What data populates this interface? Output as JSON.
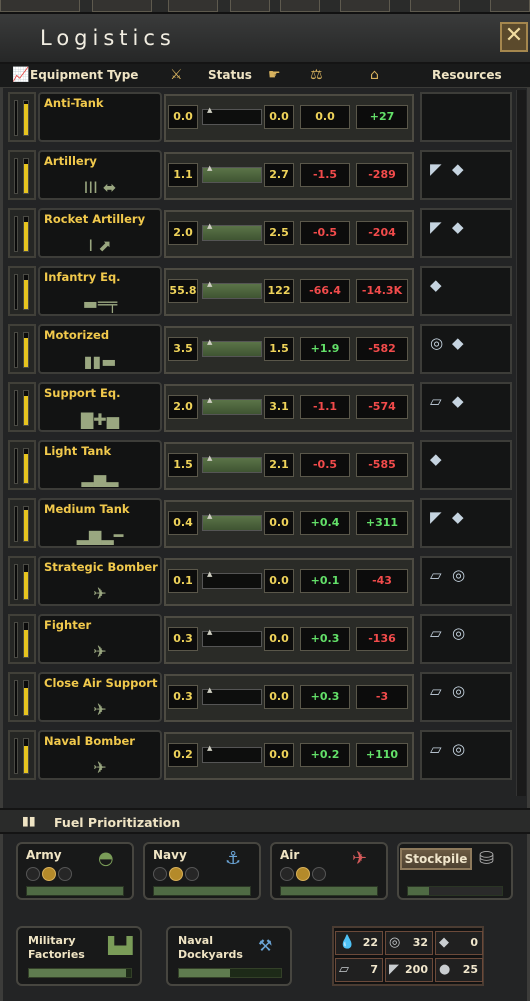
{
  "window": {
    "title": "Logistics",
    "close_label": "✕"
  },
  "header": {
    "equipment_type": "Equipment Type",
    "status": "Status",
    "resources": "Resources"
  },
  "rows": [
    {
      "name": "Anti-Tank",
      "icon": "",
      "fill": 0.9,
      "a": "0.0",
      "b": "0.0",
      "c": "0.0",
      "d": "+27",
      "c_color": "y",
      "d_color": "g",
      "track_on": false,
      "resources": []
    },
    {
      "name": "Artillery",
      "icon": "III ⬌",
      "fill": 0.85,
      "a": "1.1",
      "b": "2.7",
      "c": "-1.5",
      "d": "-289",
      "c_color": "r",
      "d_color": "r",
      "track_on": true,
      "resources": [
        "steel-icon",
        "tungsten-icon"
      ]
    },
    {
      "name": "Rocket Artillery",
      "icon": "I ⬈",
      "fill": 0.85,
      "a": "2.0",
      "b": "2.5",
      "c": "-0.5",
      "d": "-204",
      "c_color": "r",
      "d_color": "r",
      "track_on": true,
      "resources": [
        "steel-icon",
        "tungsten-icon"
      ]
    },
    {
      "name": "Infantry Eq.",
      "icon": "▬═╤",
      "fill": 0.85,
      "a": "55.8",
      "b": "122",
      "c": "-66.4",
      "d": "-14.3K",
      "c_color": "r",
      "d_color": "r",
      "track_on": true,
      "resources": [
        "tungsten-icon"
      ]
    },
    {
      "name": "Motorized",
      "icon": "▮▮▬",
      "fill": 0.85,
      "a": "3.5",
      "b": "1.5",
      "c": "+1.9",
      "d": "-582",
      "c_color": "g",
      "d_color": "r",
      "track_on": true,
      "resources": [
        "rubber-icon",
        "tungsten-icon"
      ]
    },
    {
      "name": "Support Eq.",
      "icon": "▇✚▅",
      "fill": 0.85,
      "a": "2.0",
      "b": "3.1",
      "c": "-1.1",
      "d": "-574",
      "c_color": "r",
      "d_color": "r",
      "track_on": true,
      "resources": [
        "aluminium-icon",
        "tungsten-icon"
      ]
    },
    {
      "name": "Light Tank",
      "icon": "▂▅▂",
      "fill": 0.85,
      "a": "1.5",
      "b": "2.1",
      "c": "-0.5",
      "d": "-585",
      "c_color": "r",
      "d_color": "r",
      "track_on": true,
      "resources": [
        "tungsten-icon"
      ]
    },
    {
      "name": "Medium Tank",
      "icon": "▂▆▂━",
      "fill": 0.9,
      "a": "0.4",
      "b": "0.0",
      "c": "+0.4",
      "d": "+311",
      "c_color": "g",
      "d_color": "g",
      "track_on": true,
      "resources": [
        "steel-icon",
        "tungsten-icon"
      ]
    },
    {
      "name": "Strategic Bomber",
      "icon": "✈",
      "fill": 0.8,
      "a": "0.1",
      "b": "0.0",
      "c": "+0.1",
      "d": "-43",
      "c_color": "g",
      "d_color": "r",
      "track_on": false,
      "resources": [
        "aluminium-icon",
        "rubber-icon"
      ]
    },
    {
      "name": "Fighter",
      "icon": "✈",
      "fill": 0.8,
      "a": "0.3",
      "b": "0.0",
      "c": "+0.3",
      "d": "-136",
      "c_color": "g",
      "d_color": "r",
      "track_on": false,
      "resources": [
        "aluminium-icon",
        "rubber-icon"
      ]
    },
    {
      "name": "Close Air Support",
      "icon": "✈",
      "fill": 0.8,
      "a": "0.3",
      "b": "0.0",
      "c": "+0.3",
      "d": "-3",
      "c_color": "g",
      "d_color": "r",
      "track_on": false,
      "resources": [
        "aluminium-icon",
        "rubber-icon"
      ]
    },
    {
      "name": "Naval Bomber",
      "icon": "✈",
      "fill": 0.8,
      "a": "0.2",
      "b": "0.0",
      "c": "+0.2",
      "d": "+110",
      "c_color": "g",
      "d_color": "g",
      "track_on": false,
      "resources": [
        "aluminium-icon",
        "rubber-icon"
      ]
    }
  ],
  "fuel": {
    "title": "Fuel Prioritization",
    "army": "Army",
    "navy": "Navy",
    "air": "Air",
    "stockpile": "Stockpile"
  },
  "bottom": {
    "military_1": "Military",
    "military_2": "Factories",
    "naval_1": "Naval",
    "naval_2": "Dockyards",
    "military_progress": 0.95,
    "naval_progress": 0.5
  },
  "stockpile_resources": {
    "oil": "22",
    "rubber": "32",
    "tungsten": "0",
    "aluminium": "7",
    "steel": "200",
    "chromium": "25"
  }
}
